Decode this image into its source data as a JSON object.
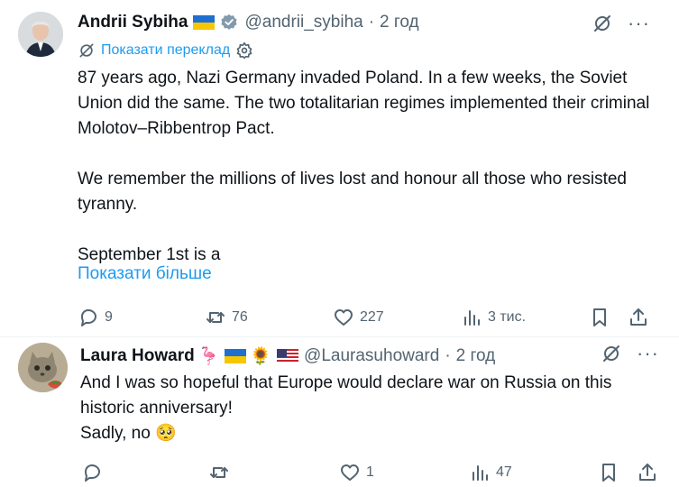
{
  "tweets": [
    {
      "author_name": "Andrii Sybiha",
      "handle": "@andrii_sybiha",
      "separator": "·",
      "time": "2 год",
      "translate_label": "Показати переклад",
      "text": "87 years ago, Nazi Germany invaded Poland. In a few weeks, the Soviet Union did the same. The two totalitarian regimes implemented their criminal Molotov–Ribbentrop Pact.\n\nWe remember the millions of lives lost and honour all those who resisted tyranny.\n\nSeptember 1st is a",
      "show_more": "Показати більше",
      "replies": "9",
      "reposts": "76",
      "likes": "227",
      "views": "3 тис."
    },
    {
      "author_name": "Laura Howard",
      "name_emojis": "🦩",
      "sunflower": "🌻",
      "handle": "@Laurasuhoward",
      "separator": "·",
      "time": "2 год",
      "text": "And I was so hopeful that Europe would declare war on Russia on this historic anniversary!\nSadly, no 🥺",
      "replies": "",
      "reposts": "",
      "likes": "1",
      "views": "47"
    }
  ],
  "more_label": "···",
  "colors": {
    "accent": "#1d9bf0",
    "muted": "#536471",
    "text": "#0f1419"
  }
}
